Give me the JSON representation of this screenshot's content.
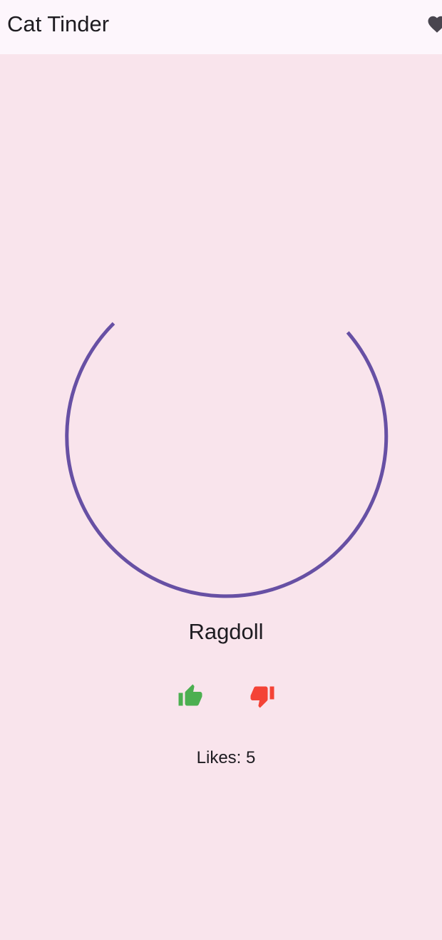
{
  "app_bar": {
    "title": "Cat Tinder",
    "favorites_icon": "heart-icon"
  },
  "main": {
    "loading_indicator": "circular-progress",
    "cat_name": "Ragdoll",
    "like_icon": "thumb-up-icon",
    "dislike_icon": "thumb-down-icon",
    "likes_text": "Likes: 5"
  },
  "colors": {
    "background": "#f9e4ec",
    "app_bar_background": "#fdf6fc",
    "progress": "#6750a4",
    "like": "#4caf50",
    "dislike": "#f44336",
    "heart": "#49454f"
  }
}
